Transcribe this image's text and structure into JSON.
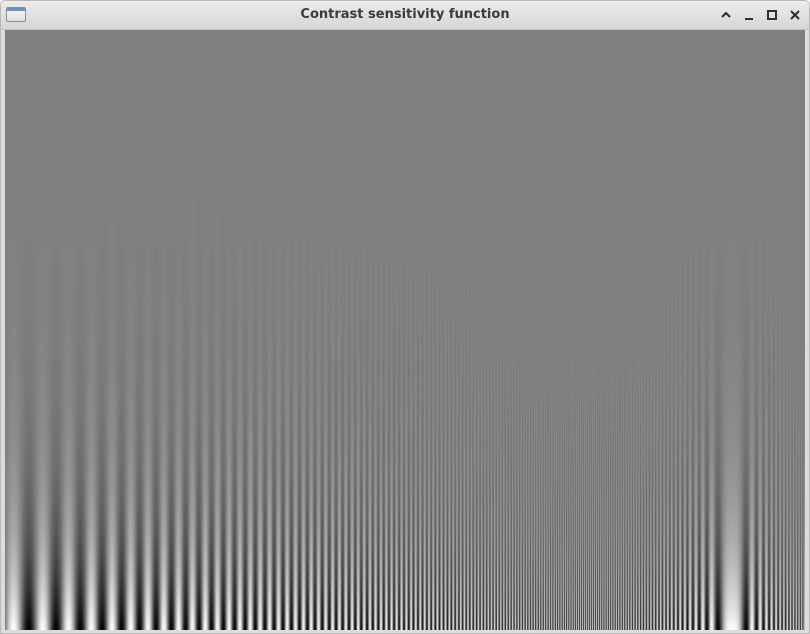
{
  "window": {
    "title": "Contrast sensitivity function",
    "icons": {
      "app": "window-app-icon",
      "shade": "chevron-up-icon",
      "minimize": "minimize-icon",
      "maximize": "maximize-icon",
      "close": "close-icon"
    }
  },
  "content": {
    "image": "campbell-robson-contrast-sensitivity-grating",
    "background_gray": "#808080"
  }
}
